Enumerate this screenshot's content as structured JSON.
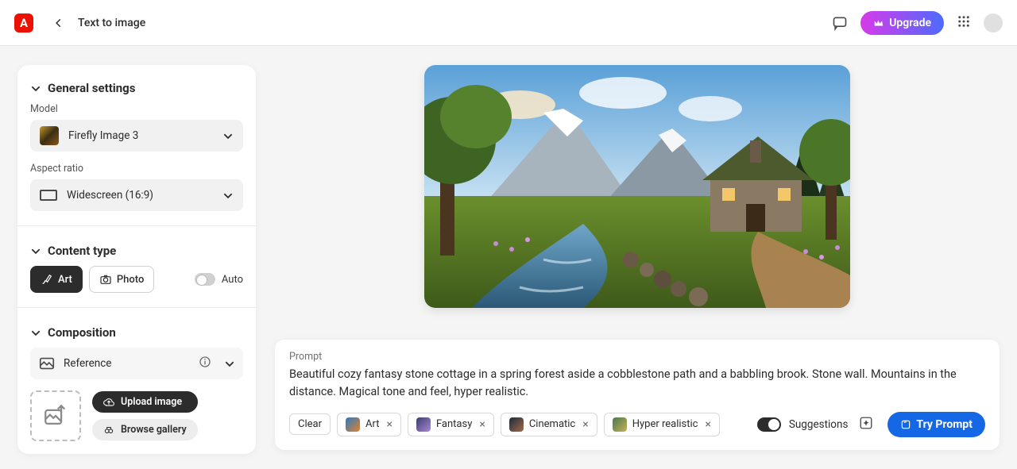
{
  "header": {
    "title": "Text to image",
    "upgrade_label": "Upgrade"
  },
  "sidebar": {
    "general_label": "General settings",
    "model_label": "Model",
    "model_value": "Firefly Image 3",
    "aspect_label": "Aspect ratio",
    "aspect_value": "Widescreen (16:9)",
    "content_type_label": "Content type",
    "art_label": "Art",
    "photo_label": "Photo",
    "auto_label": "Auto",
    "composition_label": "Composition",
    "reference_label": "Reference",
    "upload_label": "Upload image",
    "browse_label": "Browse gallery"
  },
  "prompt": {
    "label": "Prompt",
    "text": "Beautiful cozy fantasy stone cottage in a spring forest aside a cobblestone path and a babbling brook. Stone wall. Mountains in the distance. Magical tone and feel, hyper realistic.",
    "clear_label": "Clear",
    "tags": [
      {
        "label": "Art"
      },
      {
        "label": "Fantasy"
      },
      {
        "label": "Cinematic"
      },
      {
        "label": "Hyper realistic"
      }
    ],
    "suggestions_label": "Suggestions",
    "try_label": "Try Prompt"
  }
}
